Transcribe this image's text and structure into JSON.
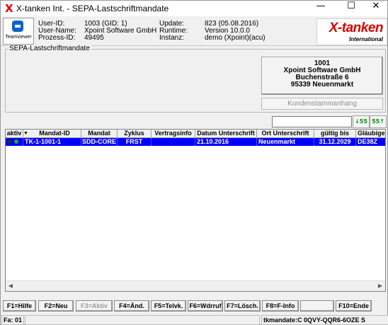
{
  "window": {
    "title": "X-tanken Int. - SEPA-Lastschriftmandate",
    "app_icon": "X",
    "minimize_glyph": "—",
    "maximize_glyph": "☐",
    "close_glyph": "✕"
  },
  "header": {
    "teamviewer_label": "Teamviewer",
    "user_id_label": "User-ID:",
    "user_id_value": "1003 (GID: 1)",
    "user_name_label": "User-Name:",
    "user_name_value": "Xpoint Software GmbH",
    "prozess_id_label": "Prozess-ID:",
    "prozess_id_value": "49495",
    "update_label": "Update:",
    "update_value": "823 (05.08.2016)",
    "runtime_label": "Runtime:",
    "runtime_value": "Version 10.0.0",
    "instanz_label": "Instanz:",
    "instanz_value": "demo (Xpoint)(acu)",
    "logo_main": "X-tanken",
    "logo_sub": "International"
  },
  "group": {
    "title": "SEPA-Lastschriftmandate",
    "address": {
      "number": "1001",
      "company": "Xpoint Software GmbH",
      "street": "Buchenstraße 6",
      "city": "95339 Neuenmarkt"
    },
    "kundenstamm_button": "Kundenstammanhang"
  },
  "search": {
    "value": "",
    "btn_down_label": "↓55",
    "btn_up_label": "55↑"
  },
  "table": {
    "columns": [
      "aktiv",
      "Mandat-ID",
      "Mandat",
      "Zyklus",
      "Vertragsinfo",
      "Datum Unterschrift",
      "Ort Unterschrift",
      "gültig bis",
      "Gläubiger"
    ],
    "rows": [
      {
        "aktiv": "",
        "mandat_id": "TK-1-1001-1",
        "mandat": "SDD-CORE",
        "zyklus": "FRST",
        "vertragsinfo": "",
        "datum": "21.10.2016",
        "ort": "Neuenmarkt",
        "gueltig_bis": "31.12.2029",
        "glaeubiger": "DE38Z"
      }
    ],
    "sort_icon": "▼",
    "scroll_left": "◀",
    "scroll_right": "▶"
  },
  "function_keys": {
    "f1": "F1=Hilfe",
    "f2": "F2=Neu",
    "f3": "F3=Aktiv",
    "f4": "F4=Änd.",
    "f5": "F5=Telvk.",
    "f6": "F6=Wdrruf",
    "f7": "F7=Lösch.",
    "f8": "F8=F-Info",
    "f9": "",
    "f10": "F10=Ende"
  },
  "statusbar": {
    "left": "Fa: 01",
    "right": "tkmandate:C 0QVY-QQR6-6OZE S"
  },
  "colors": {
    "selection": "#0000ff",
    "logo_red": "#d90000",
    "status_green": "#22b022"
  }
}
